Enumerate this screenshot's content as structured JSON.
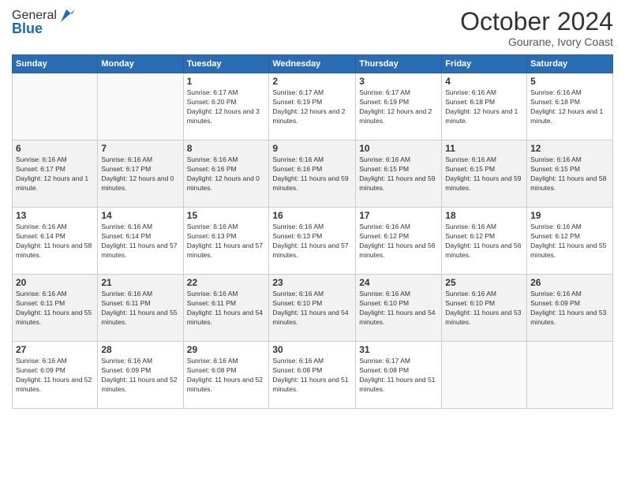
{
  "logo": {
    "general": "General",
    "blue": "Blue"
  },
  "header": {
    "month": "October 2024",
    "location": "Gourane, Ivory Coast"
  },
  "weekdays": [
    "Sunday",
    "Monday",
    "Tuesday",
    "Wednesday",
    "Thursday",
    "Friday",
    "Saturday"
  ],
  "weeks": [
    [
      {
        "day": "",
        "info": ""
      },
      {
        "day": "",
        "info": ""
      },
      {
        "day": "1",
        "info": "Sunrise: 6:17 AM\nSunset: 6:20 PM\nDaylight: 12 hours and 3 minutes."
      },
      {
        "day": "2",
        "info": "Sunrise: 6:17 AM\nSunset: 6:19 PM\nDaylight: 12 hours and 2 minutes."
      },
      {
        "day": "3",
        "info": "Sunrise: 6:17 AM\nSunset: 6:19 PM\nDaylight: 12 hours and 2 minutes."
      },
      {
        "day": "4",
        "info": "Sunrise: 6:16 AM\nSunset: 6:18 PM\nDaylight: 12 hours and 1 minute."
      },
      {
        "day": "5",
        "info": "Sunrise: 6:16 AM\nSunset: 6:18 PM\nDaylight: 12 hours and 1 minute."
      }
    ],
    [
      {
        "day": "6",
        "info": "Sunrise: 6:16 AM\nSunset: 6:17 PM\nDaylight: 12 hours and 1 minute."
      },
      {
        "day": "7",
        "info": "Sunrise: 6:16 AM\nSunset: 6:17 PM\nDaylight: 12 hours and 0 minutes."
      },
      {
        "day": "8",
        "info": "Sunrise: 6:16 AM\nSunset: 6:16 PM\nDaylight: 12 hours and 0 minutes."
      },
      {
        "day": "9",
        "info": "Sunrise: 6:16 AM\nSunset: 6:16 PM\nDaylight: 11 hours and 59 minutes."
      },
      {
        "day": "10",
        "info": "Sunrise: 6:16 AM\nSunset: 6:15 PM\nDaylight: 11 hours and 59 minutes."
      },
      {
        "day": "11",
        "info": "Sunrise: 6:16 AM\nSunset: 6:15 PM\nDaylight: 11 hours and 59 minutes."
      },
      {
        "day": "12",
        "info": "Sunrise: 6:16 AM\nSunset: 6:15 PM\nDaylight: 11 hours and 58 minutes."
      }
    ],
    [
      {
        "day": "13",
        "info": "Sunrise: 6:16 AM\nSunset: 6:14 PM\nDaylight: 11 hours and 58 minutes."
      },
      {
        "day": "14",
        "info": "Sunrise: 6:16 AM\nSunset: 6:14 PM\nDaylight: 11 hours and 57 minutes."
      },
      {
        "day": "15",
        "info": "Sunrise: 6:16 AM\nSunset: 6:13 PM\nDaylight: 11 hours and 57 minutes."
      },
      {
        "day": "16",
        "info": "Sunrise: 6:16 AM\nSunset: 6:13 PM\nDaylight: 11 hours and 57 minutes."
      },
      {
        "day": "17",
        "info": "Sunrise: 6:16 AM\nSunset: 6:12 PM\nDaylight: 11 hours and 56 minutes."
      },
      {
        "day": "18",
        "info": "Sunrise: 6:16 AM\nSunset: 6:12 PM\nDaylight: 11 hours and 56 minutes."
      },
      {
        "day": "19",
        "info": "Sunrise: 6:16 AM\nSunset: 6:12 PM\nDaylight: 11 hours and 55 minutes."
      }
    ],
    [
      {
        "day": "20",
        "info": "Sunrise: 6:16 AM\nSunset: 6:11 PM\nDaylight: 11 hours and 55 minutes."
      },
      {
        "day": "21",
        "info": "Sunrise: 6:16 AM\nSunset: 6:11 PM\nDaylight: 11 hours and 55 minutes."
      },
      {
        "day": "22",
        "info": "Sunrise: 6:16 AM\nSunset: 6:11 PM\nDaylight: 11 hours and 54 minutes."
      },
      {
        "day": "23",
        "info": "Sunrise: 6:16 AM\nSunset: 6:10 PM\nDaylight: 11 hours and 54 minutes."
      },
      {
        "day": "24",
        "info": "Sunrise: 6:16 AM\nSunset: 6:10 PM\nDaylight: 11 hours and 54 minutes."
      },
      {
        "day": "25",
        "info": "Sunrise: 6:16 AM\nSunset: 6:10 PM\nDaylight: 11 hours and 53 minutes."
      },
      {
        "day": "26",
        "info": "Sunrise: 6:16 AM\nSunset: 6:09 PM\nDaylight: 11 hours and 53 minutes."
      }
    ],
    [
      {
        "day": "27",
        "info": "Sunrise: 6:16 AM\nSunset: 6:09 PM\nDaylight: 11 hours and 52 minutes."
      },
      {
        "day": "28",
        "info": "Sunrise: 6:16 AM\nSunset: 6:09 PM\nDaylight: 11 hours and 52 minutes."
      },
      {
        "day": "29",
        "info": "Sunrise: 6:16 AM\nSunset: 6:08 PM\nDaylight: 11 hours and 52 minutes."
      },
      {
        "day": "30",
        "info": "Sunrise: 6:16 AM\nSunset: 6:08 PM\nDaylight: 11 hours and 51 minutes."
      },
      {
        "day": "31",
        "info": "Sunrise: 6:17 AM\nSunset: 6:08 PM\nDaylight: 11 hours and 51 minutes."
      },
      {
        "day": "",
        "info": ""
      },
      {
        "day": "",
        "info": ""
      }
    ]
  ]
}
